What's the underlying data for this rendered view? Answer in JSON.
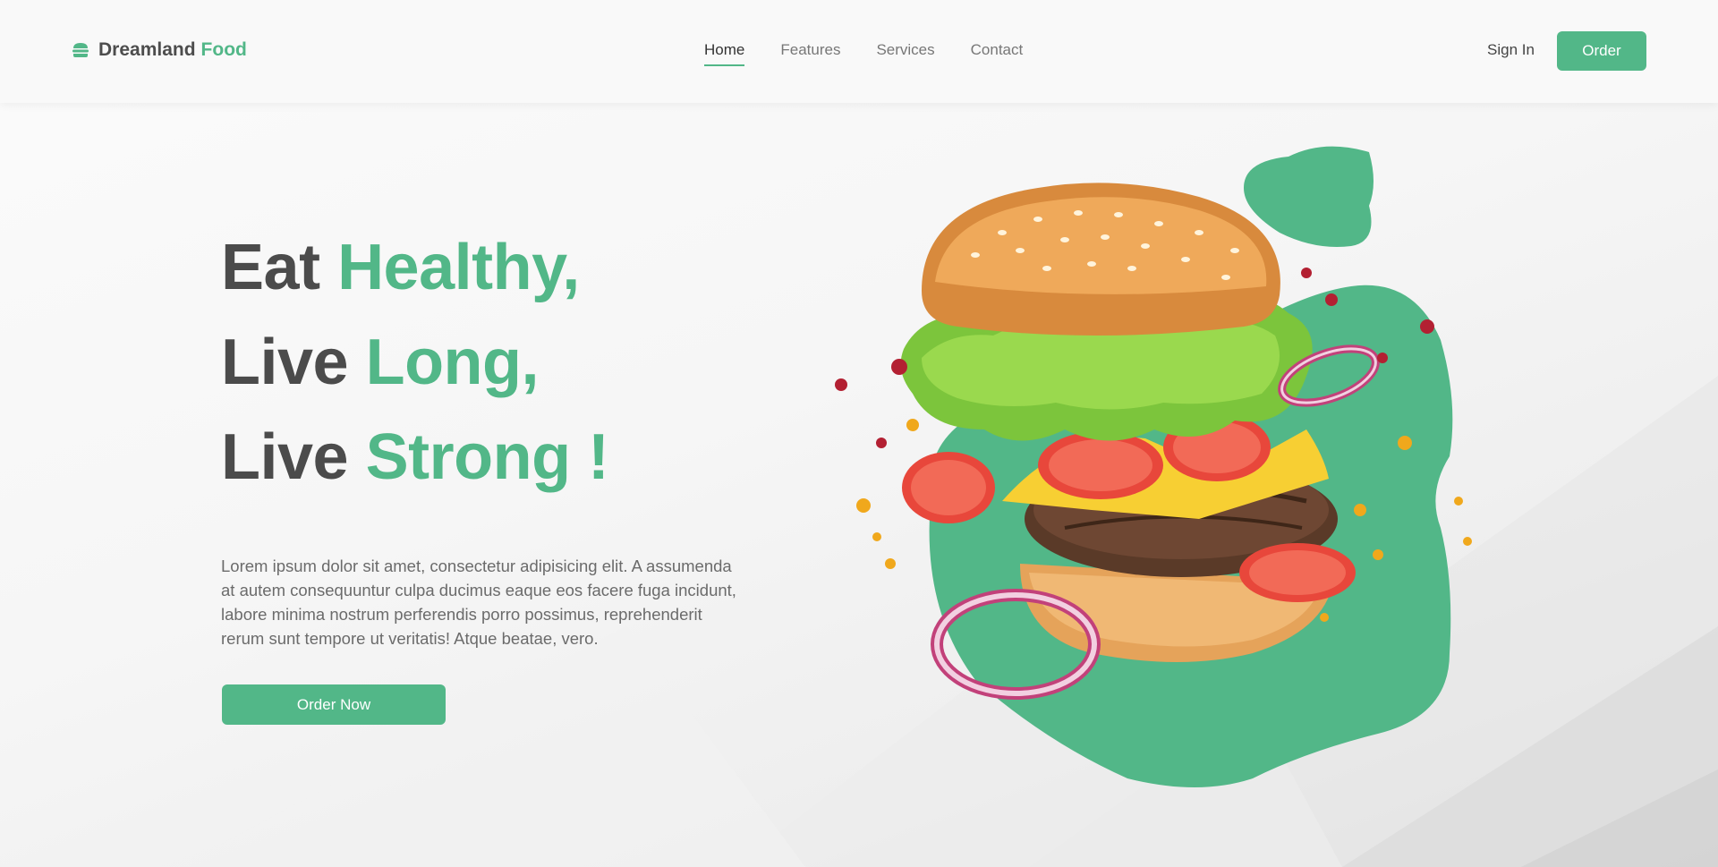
{
  "colors": {
    "accent": "#52b788",
    "text_dark": "#4b4b4b",
    "text_muted": "#6b6b6b"
  },
  "header": {
    "logo": {
      "icon": "burger-icon",
      "name_part1": "Dreamland",
      "name_part2": "Food"
    },
    "nav": [
      {
        "label": "Home",
        "active": true
      },
      {
        "label": "Features",
        "active": false
      },
      {
        "label": "Services",
        "active": false
      },
      {
        "label": "Contact",
        "active": false
      }
    ],
    "sign_in_label": "Sign In",
    "order_label": "Order"
  },
  "hero": {
    "line1": {
      "plain": "Eat",
      "accent": "Healthy,"
    },
    "line2": {
      "plain": "Live",
      "accent": "Long,"
    },
    "line3": {
      "plain": "Live",
      "accent": "Strong !"
    },
    "description": "Lorem ipsum dolor sit amet, consectetur adipisicing elit. A assumenda at autem consequuntur culpa ducimus eaque eos facere fuga incidunt, labore minima nostrum perferendis porro possimus, reprehenderit rerum sunt tempore ut veritatis! Atque beatae, vero.",
    "cta_label": "Order Now",
    "image": "burger-illustration"
  }
}
